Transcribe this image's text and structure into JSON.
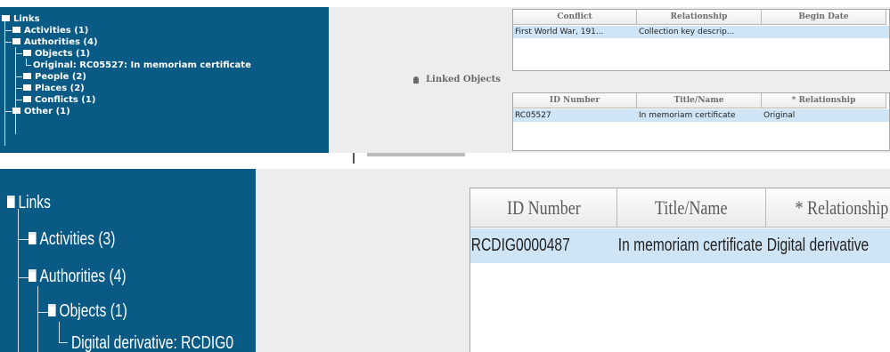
{
  "top": {
    "tree": {
      "root": "Links",
      "activities": "Activities (1)",
      "authorities": "Authorities (4)",
      "objects": "Objects (1)",
      "original": "Original: RC05527: In memoriam certificate",
      "people": "People (2)",
      "places": "Places (2)",
      "conflicts": "Conflicts (1)",
      "other": "Other (1)"
    },
    "conflict_grid": {
      "headers": [
        "Conflict",
        "Relationship",
        "Begin Date"
      ],
      "row": [
        "First World War, 191...",
        "Collection key descrip...",
        ""
      ]
    },
    "linked_objects_label": "Linked Objects",
    "linked_grid": {
      "headers": [
        "ID Number",
        "Title/Name",
        "* Relationship"
      ],
      "row": [
        "RC05527",
        "In memoriam certificate",
        "Original"
      ]
    }
  },
  "bottom": {
    "tree": {
      "root": "Links",
      "activities": "Activities (3)",
      "authorities": "Authorities (4)",
      "objects": "Objects (1)",
      "derivative": "Digital derivative: RCDIG0"
    },
    "linked_grid": {
      "headers": [
        "ID Number",
        "Title/Name",
        "* Relationship"
      ],
      "row": [
        "RCDIG0000487",
        "In memoriam certificate",
        "Digital derivative"
      ]
    }
  },
  "colors": {
    "tree_bg": "#0a5a86",
    "panel_bg": "#ededed",
    "row_selected": "#cfe4f4"
  },
  "icons": [
    "folder-icon",
    "pin-icon"
  ]
}
